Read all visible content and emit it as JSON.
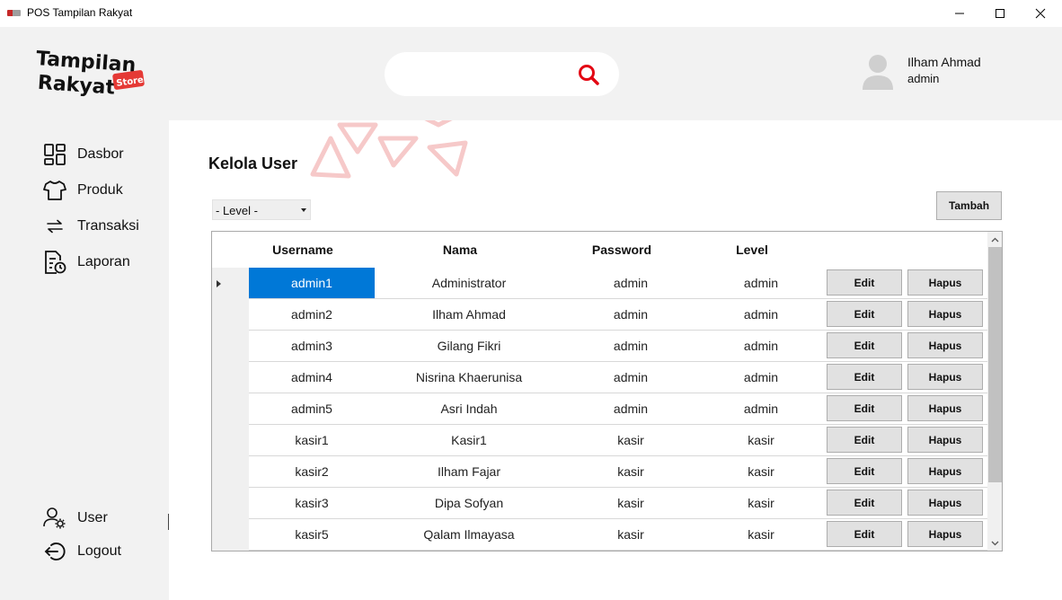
{
  "window": {
    "title": "POS Tampilan Rakyat",
    "controls": [
      "minimize-icon",
      "maximize-icon",
      "close-icon"
    ]
  },
  "brand": {
    "line1": "Tampilan",
    "line2": "Rakyat",
    "badge": "Store",
    "colors": {
      "text": "#111111",
      "badge": "#e53935"
    }
  },
  "search": {
    "value": "",
    "placeholder": "",
    "icon": "search-icon",
    "icon_color": "#e30613"
  },
  "user": {
    "name": "Ilham Ahmad",
    "role": "admin",
    "icon": "avatar-icon"
  },
  "sidebar": {
    "items": [
      {
        "label": "Dasbor",
        "icon": "dashboard-grid-icon"
      },
      {
        "label": "Produk",
        "icon": "tshirt-icon"
      },
      {
        "label": "Transaksi",
        "icon": "swap-arrows-icon"
      },
      {
        "label": "Laporan",
        "icon": "report-clock-icon"
      }
    ],
    "bottom": [
      {
        "label": "User",
        "icon": "user-gear-icon"
      },
      {
        "label": "Logout",
        "icon": "logout-icon"
      }
    ]
  },
  "main": {
    "title": "Kelola User",
    "level_filter": {
      "selected": "- Level -"
    },
    "add_button": "Tambah",
    "table": {
      "columns": [
        "Username",
        "Nama",
        "Password",
        "Level"
      ],
      "rows": [
        {
          "username": "admin1",
          "nama": "Administrator",
          "password": "admin",
          "level": "admin",
          "edit": "Edit",
          "hapus": "Hapus"
        },
        {
          "username": "admin2",
          "nama": "Ilham Ahmad",
          "password": "admin",
          "level": "admin",
          "edit": "Edit",
          "hapus": "Hapus"
        },
        {
          "username": "admin3",
          "nama": "Gilang Fikri",
          "password": "admin",
          "level": "admin",
          "edit": "Edit",
          "hapus": "Hapus"
        },
        {
          "username": "admin4",
          "nama": "Nisrina Khaerunisa",
          "password": "admin",
          "level": "admin",
          "edit": "Edit",
          "hapus": "Hapus"
        },
        {
          "username": "admin5",
          "nama": "Asri Indah",
          "password": "admin",
          "level": "admin",
          "edit": "Edit",
          "hapus": "Hapus"
        },
        {
          "username": "kasir1",
          "nama": "Kasir1",
          "password": "kasir",
          "level": "kasir",
          "edit": "Edit",
          "hapus": "Hapus"
        },
        {
          "username": "kasir2",
          "nama": "Ilham Fajar",
          "password": "kasir",
          "level": "kasir",
          "edit": "Edit",
          "hapus": "Hapus"
        },
        {
          "username": "kasir3",
          "nama": "Dipa Sofyan",
          "password": "kasir",
          "level": "kasir",
          "edit": "Edit",
          "hapus": "Hapus"
        },
        {
          "username": "kasir5",
          "nama": "Qalam Ilmayasa",
          "password": "kasir",
          "level": "kasir",
          "edit": "Edit",
          "hapus": "Hapus"
        }
      ],
      "selected_row": 0,
      "selection_color": "#0078d7"
    }
  }
}
